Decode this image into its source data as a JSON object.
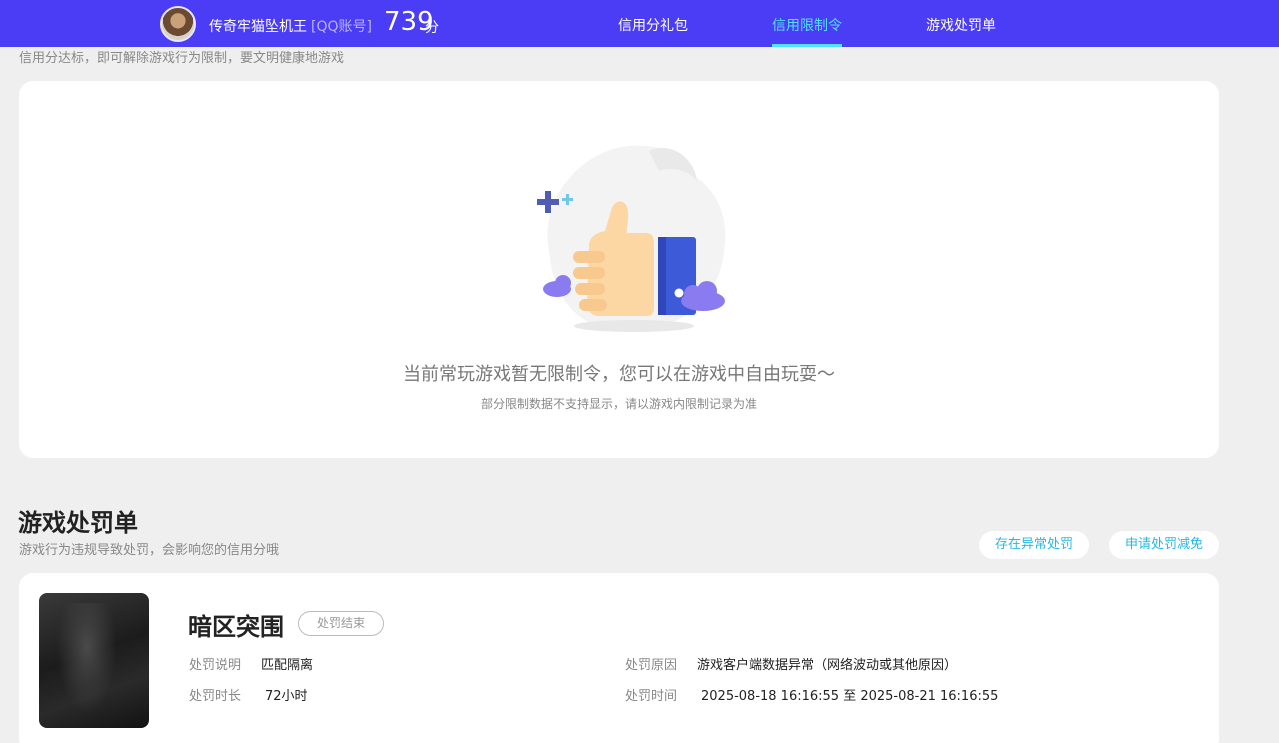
{
  "header": {
    "username": "传奇牢猫坠机王",
    "account_type": "[QQ账号]",
    "score": "739",
    "score_unit": "分",
    "tabs": [
      {
        "label": "信用分礼包",
        "active": false
      },
      {
        "label": "信用限制令",
        "active": true
      },
      {
        "label": "游戏处罚单",
        "active": false
      }
    ],
    "accent_color": "#4b3cf5",
    "active_tab_color": "#4fe3ff"
  },
  "intro_text": "信用分达标，即可解除游戏行为限制，要文明健康地游戏",
  "empty_state": {
    "icon": "thumbs-up-illustration",
    "title": "当前常玩游戏暂无限制令，您可以在游戏中自由玩耍～",
    "subtitle": "部分限制数据不支持显示，请以游戏内限制记录为准"
  },
  "penalty_section": {
    "title": "游戏处罚单",
    "subtitle": "游戏行为违规导致处罚，会影响您的信用分哦",
    "buttons": [
      "存在异常处罚",
      "申请处罚减免"
    ],
    "button_color": "#26b8e6"
  },
  "penalty": {
    "game_name": "暗区突围",
    "status": "处罚结束",
    "desc_label": "处罚说明",
    "desc_value": "匹配隔离",
    "duration_label": "处罚时长",
    "duration_value": "72小时",
    "reason_label": "处罚原因",
    "reason_value": "游戏客户端数据异常（网络波动或其他原因）",
    "time_label": "处罚时间",
    "time_value": "2025-08-18 16:16:55 至 2025-08-21 16:16:55"
  }
}
